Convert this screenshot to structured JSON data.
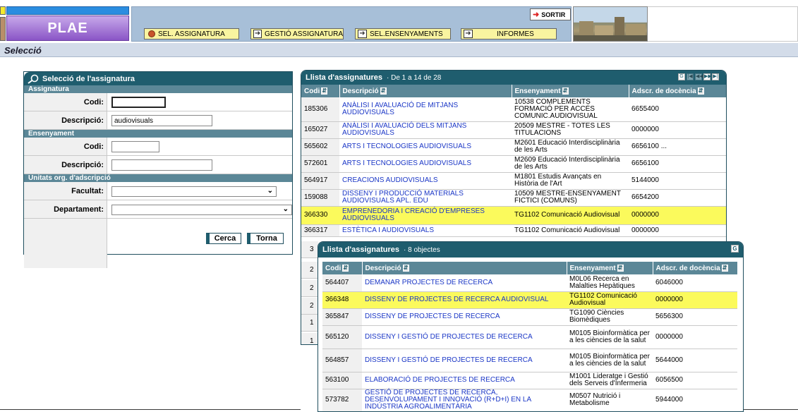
{
  "header": {
    "app_name": "PLAE",
    "exit_label": "SORTIR",
    "menu": [
      {
        "label": "SEL. ASSIGNATURA",
        "icon": "circle-dot-icon"
      },
      {
        "label": "GESTIÓ ASSIGNATURA",
        "icon": "arrow-right-icon"
      },
      {
        "label": "SEL.ENSENYAMENTS",
        "icon": "arrow-right-icon"
      },
      {
        "label": "INFORMES",
        "icon": "arrow-right-icon"
      }
    ]
  },
  "page": {
    "title": "Selecció"
  },
  "selection_form": {
    "title": "Selecció de l'assignatura",
    "section_assignatura": "Assignatura",
    "codi_label": "Codi:",
    "codi_value": "",
    "descripcio_label": "Descripció:",
    "descripcio_value": "audiovisuals",
    "section_ensenyament": "Ensenyament",
    "ens_codi_label": "Codi:",
    "ens_codi_value": "",
    "ens_descripcio_label": "Descripció:",
    "ens_descripcio_value": "",
    "section_unitats": "Unitats org. d'adscripció",
    "facultat_label": "Facultat:",
    "facultat_value": "",
    "departament_label": "Departament:",
    "departament_value": "",
    "search_button": "Cerca",
    "back_button": "Torna"
  },
  "list1": {
    "title": "Llista d'assignatures",
    "count": "· De 1 a 14 de 28",
    "columns": [
      "Codi",
      "Descripció",
      "Ensenyament",
      "Adscr. de docència"
    ],
    "rows": [
      {
        "codi": "185306",
        "descripcio": "ANÀLISI I AVALUACIÓ DE MITJANS AUDIOVISUALS",
        "ensenyament": "10538 COMPLEMENTS FORMACIÓ PER ACCÉS COMUNIC.AUDIOVISUAL",
        "adscr": "6655400",
        "highlight": false
      },
      {
        "codi": "165027",
        "descripcio": "ANÀLISI I AVALUACIÓ DELS MITJANS AUDIOVISUALS",
        "ensenyament": "20509 MESTRE - TOTES LES TITULACIONS",
        "adscr": "0000000",
        "highlight": false
      },
      {
        "codi": "565602",
        "descripcio": "ARTS I TECNOLOGIES AUDIOVISUALS",
        "ensenyament": "M2601 Educació Interdisciplinària de les Arts",
        "adscr": "6656100 ...",
        "highlight": false
      },
      {
        "codi": "572601",
        "descripcio": "ARTS I TECNOLOGIES AUDIOVISUALS",
        "ensenyament": "M2609 Educació Interdisciplinària de les Arts",
        "adscr": "6656100",
        "highlight": false
      },
      {
        "codi": "564917",
        "descripcio": "CREACIONS AUDIOVISUALS",
        "ensenyament": "M1801 Estudis Avançats en Història de l'Art",
        "adscr": "5144000",
        "highlight": false
      },
      {
        "codi": "159088",
        "descripcio": "DISSENY I PRODUCCIÓ MATERIALS AUDIOVISUALS APL. EDU",
        "ensenyament": "10509 MESTRE-ENSENYAMENT FICTICI (COMUNS)",
        "adscr": "6654200",
        "highlight": false
      },
      {
        "codi": "366330",
        "descripcio": "EMPRENEDORIA I CREACIÓ D'EMPRESES AUDIOVISUALS",
        "ensenyament": "TG1102 Comunicació Audiovisual",
        "adscr": "0000000",
        "highlight": true
      },
      {
        "codi": "366317",
        "descripcio": "ESTÈTICA I AUDIOVISUALS",
        "ensenyament": "TG1102 Comunicació Audiovisual",
        "adscr": "0000000",
        "highlight": false
      }
    ],
    "partial_codes": [
      "3",
      "2",
      "2",
      "2",
      "1",
      "1"
    ]
  },
  "list2": {
    "title": "Llista d'assignatures",
    "count": "· 8 objectes",
    "columns": [
      "Codi",
      "Descripció",
      "Ensenyament",
      "Adscr. de docència"
    ],
    "rows": [
      {
        "codi": "564407",
        "descripcio": "DEMANAR PROJECTES DE RECERCA",
        "ensenyament": "M0L06 Recerca en Malalties Hepàtiques",
        "adscr": "6046000",
        "highlight": false
      },
      {
        "codi": "366348",
        "descripcio": "DISSENY DE PROJECTES DE RECERCA AUDIOVISUAL",
        "ensenyament": "TG1102 Comunicació Audiovisual",
        "adscr": "0000000",
        "highlight": true
      },
      {
        "codi": "365847",
        "descripcio": "DISSENY DE PROJECTES DE RECERCA",
        "ensenyament": "TG1090 Ciències Biomèdiques",
        "adscr": "5656300",
        "highlight": false
      },
      {
        "codi": "565120",
        "descripcio": "DISSENY I GESTIÓ DE PROJECTES DE RECERCA",
        "ensenyament": "M0105 Bioinformàtica per a les ciències de la salut",
        "adscr": "0000000",
        "highlight": false
      },
      {
        "codi": "564857",
        "descripcio": "DISSENY I GESTIÓ DE PROJECTES DE RECERCA",
        "ensenyament": "M0105 Bioinformàtica per a les ciències de la salut",
        "adscr": "5644000",
        "highlight": false
      },
      {
        "codi": "563100",
        "descripcio": "ELABORACIÓ DE PROJECTES DE RECERCA",
        "ensenyament": "M1001 Lideratge i Gestió dels Serveis d'Infermeria",
        "adscr": "6056500",
        "highlight": false
      },
      {
        "codi": "573782",
        "descripcio": "GESTIÓ DE PROJECTES DE RECERCA, DESENVOLUPAMENT I INNOVACIÓ (R+D+I) EN LA INDÚSTRIA AGROALIMENTÀRIA",
        "ensenyament": "M0507 Nutrició i Metabolisme",
        "adscr": "5944000",
        "highlight": false
      }
    ]
  },
  "colors": {
    "panel_header": "#1f5d6e",
    "column_header": "#5b8797",
    "highlight": "#fbfa5c",
    "link": "#1a36c6",
    "menu_bar": "#a7bfd8"
  }
}
